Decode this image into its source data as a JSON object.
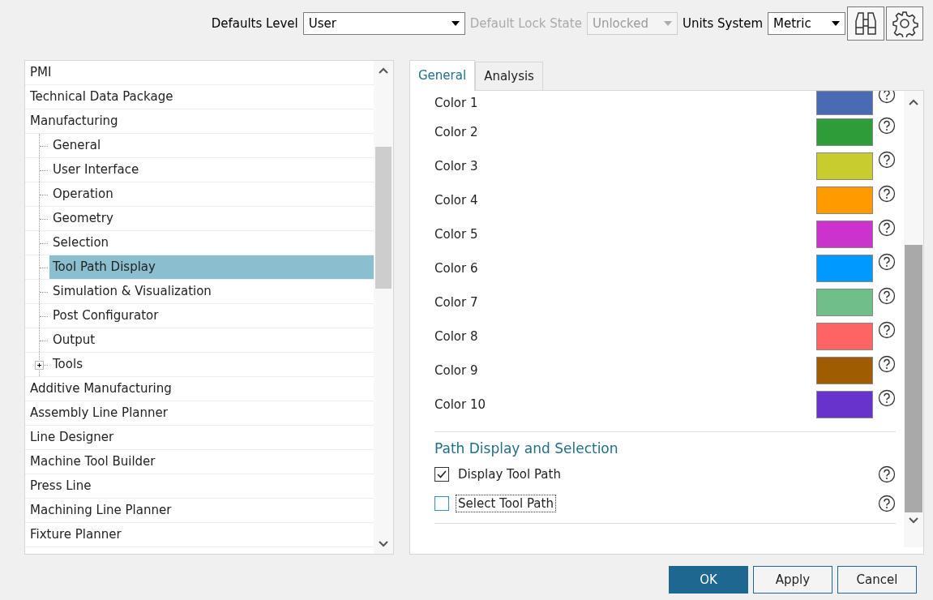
{
  "toolbar": {
    "defaults_level": {
      "label": "Defaults Level",
      "value": "User"
    },
    "lock_state": {
      "label": "Default Lock State",
      "value": "Unlocked",
      "disabled": true
    },
    "units_system": {
      "label": "Units System",
      "value": "Metric"
    }
  },
  "tree": {
    "items": [
      {
        "label": "PMI",
        "selected": false
      },
      {
        "label": "Technical Data Package",
        "selected": false
      },
      {
        "label": "Manufacturing",
        "selected": false,
        "children": [
          {
            "label": "General",
            "selected": false
          },
          {
            "label": "User Interface",
            "selected": false
          },
          {
            "label": "Operation",
            "selected": false
          },
          {
            "label": "Geometry",
            "selected": false
          },
          {
            "label": "Selection",
            "selected": false
          },
          {
            "label": "Tool Path Display",
            "selected": true
          },
          {
            "label": "Simulation & Visualization",
            "selected": false
          },
          {
            "label": "Post Configurator",
            "selected": false
          },
          {
            "label": "Output",
            "selected": false
          },
          {
            "label": "Tools",
            "selected": false,
            "expanded": false
          }
        ]
      },
      {
        "label": "Additive Manufacturing",
        "selected": false
      },
      {
        "label": "Assembly Line Planner",
        "selected": false
      },
      {
        "label": "Line Designer",
        "selected": false
      },
      {
        "label": "Machine Tool Builder",
        "selected": false
      },
      {
        "label": "Press Line",
        "selected": false
      },
      {
        "label": "Machining Line Planner",
        "selected": false
      },
      {
        "label": "Fixture Planner",
        "selected": false
      }
    ]
  },
  "tabs": [
    {
      "label": "General",
      "selected": true
    },
    {
      "label": "Analysis",
      "selected": false
    }
  ],
  "colors": [
    {
      "label": "Color 1",
      "color": "#4a6ab4"
    },
    {
      "label": "Color 2",
      "color": "#2e9c38"
    },
    {
      "label": "Color 3",
      "color": "#c9cc2e"
    },
    {
      "label": "Color 4",
      "color": "#ff9a00"
    },
    {
      "label": "Color 5",
      "color": "#cc33cc"
    },
    {
      "label": "Color 6",
      "color": "#0099ff"
    },
    {
      "label": "Color 7",
      "color": "#70bf8a"
    },
    {
      "label": "Color 8",
      "color": "#ff6464"
    },
    {
      "label": "Color 9",
      "color": "#a05c00"
    },
    {
      "label": "Color 10",
      "color": "#6633cc"
    }
  ],
  "path_section": {
    "title": "Path Display and Selection",
    "options": [
      {
        "label": "Display Tool Path",
        "checked": true,
        "focused": false
      },
      {
        "label": "Select Tool Path",
        "checked": false,
        "focused": true
      }
    ]
  },
  "buttons": [
    {
      "label": "OK",
      "kind": "primary"
    },
    {
      "label": "Apply",
      "kind": "normal"
    },
    {
      "label": "Cancel",
      "kind": "normal"
    }
  ]
}
